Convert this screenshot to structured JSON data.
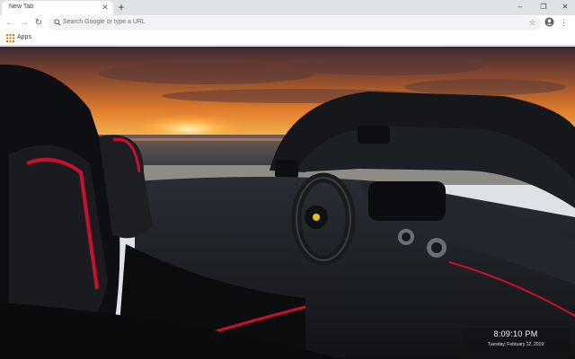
{
  "browser": {
    "tab": {
      "title": "New Tab",
      "close_icon": "close-icon"
    },
    "new_tab_symbol": "+",
    "window_controls": {
      "minimize": "–",
      "restore": "❐",
      "close": "✕"
    },
    "nav": {
      "back": "←",
      "forward": "→",
      "reload": "↻"
    },
    "omnibox": {
      "placeholder": "Search Google or type a URL"
    },
    "star_symbol": "☆",
    "menu_symbol": "⋮"
  },
  "bookmarks": {
    "apps_label": "Apps"
  },
  "newtab": {
    "wallpaper": "Ferrari convertible interior at sunset over the ocean",
    "clock": {
      "time": "8:09:10 PM",
      "date": "Tuesday, February 12, 2019"
    }
  },
  "colors": {
    "chrome_frame": "#dee1e6",
    "toolbar": "#ffffff",
    "omnibox": "#f1f3f4",
    "seat_accent": "#c8102e"
  }
}
